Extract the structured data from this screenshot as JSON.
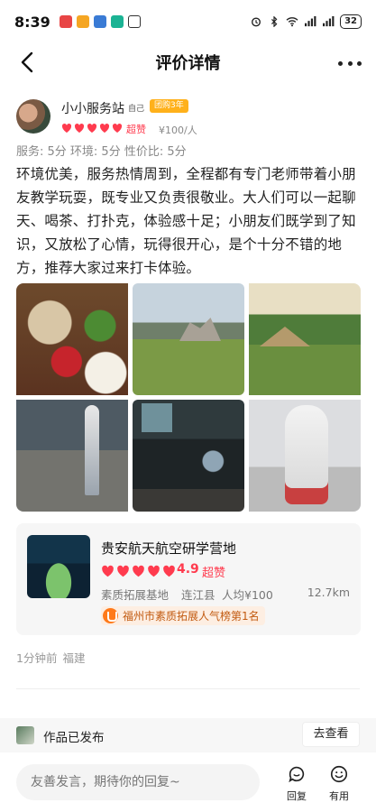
{
  "status_bar": {
    "time": "8:39",
    "battery": "32"
  },
  "nav": {
    "title": "评价详情"
  },
  "reviewer": {
    "name": "小小服务站",
    "self_tag": "自己",
    "level_tag": "团购3年",
    "hearts": 5,
    "rating_label": "超赞",
    "price": "¥100/人"
  },
  "scores": "服务: 5分 环境: 5分 性价比: 5分",
  "review_text": "环境优美，服务热情周到，全程都有专门老师带着小朋友教学玩耍，既专业又负责很敬业。大人们可以一起聊天、喝茶、打扑克，体验感十足；小朋友们既学到了知识，又放松了心情，玩得很开心，是个十分不错的地方，推荐大家过来打卡体验。",
  "photos": [
    {
      "icon": "food-photo"
    },
    {
      "icon": "garden-building-photo"
    },
    {
      "icon": "lawn-huts-photo"
    },
    {
      "icon": "space-museum-photo"
    },
    {
      "icon": "exhibit-hall-photo"
    },
    {
      "icon": "spacesuit-photo"
    }
  ],
  "poi": {
    "name": "贵安航天航空研学营地",
    "hearts": 5,
    "score": "4.9",
    "score_label": "超赞",
    "category": "素质拓展基地",
    "area": "连江县",
    "avg_price": "人均¥100",
    "distance": "12.7km",
    "rank": "福州市素质拓展人气榜第1名"
  },
  "meta": {
    "time": "1分钟前",
    "location": "福建"
  },
  "banner": {
    "text": "作品已发布",
    "button": "去查看"
  },
  "composer": {
    "placeholder": "友善发言，期待你的回复~"
  },
  "actions": {
    "reply": "回复",
    "useful": "有用"
  },
  "colors": {
    "accent": "#ff3b4e",
    "badge": "#ffb11b",
    "rank": "#ff7a1a"
  }
}
